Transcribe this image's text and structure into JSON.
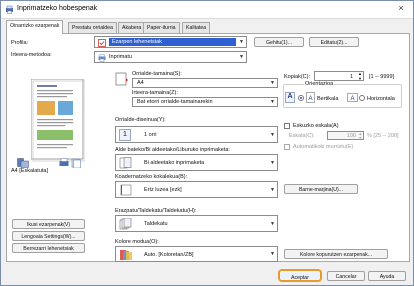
{
  "window": {
    "title": "Inprimatzeko hobespenak",
    "close": "×"
  },
  "tabs": [
    {
      "label": "Oinarrizko ezarpenak"
    },
    {
      "label": "Prestatu orrialdea"
    },
    {
      "label": "Akabera"
    },
    {
      "label": "Paper-iturria"
    },
    {
      "label": "Kalitatea"
    }
  ],
  "profile": {
    "label": "Profila:",
    "value": "Ezarpen lehenetsiak",
    "add_button": "Gehitu(1)...",
    "edit_button": "Editatu(2)..."
  },
  "output": {
    "label": "Irteera-metodoa:",
    "value": "Inprimatu"
  },
  "preview": {
    "paper_label": "A4 [Eskalatuta]"
  },
  "original_size": {
    "label": "Orrialde-tamaina(S):",
    "value": "A4"
  },
  "output_size": {
    "label": "Irteera-tamaina(Z):",
    "value": "Bat etorri orrialde-tamainarekin"
  },
  "copies": {
    "label": "Kopiak(C):",
    "value": "1",
    "range": "[1 -- 9999]"
  },
  "orientation": {
    "label": "Orientazioa",
    "vertical": "Bertikala",
    "horizontal": "Horizontala",
    "selected": "vertical"
  },
  "layout": {
    "label": "Orrialde-diseinua(Y):",
    "value": "1 orri"
  },
  "manual_scaling": {
    "label": "Eskuzko eskala(A)",
    "scale_label": "Eskala(C):",
    "scale_value": "100",
    "scale_range": "% [25 -- 200]"
  },
  "auto_reduce": {
    "label": "Automatikoki murriztu(E)"
  },
  "one_two_sided": {
    "label": "Alde bateko/Bi aldeetako/Liburuko inprimaketa:",
    "value": "Bi aldeetako inprimaketa"
  },
  "binding": {
    "label": "Koadernatzeko kokalekua(B):",
    "value": "Ertz luzea [ezk]",
    "margin_button": "Barne-marjina(U)..."
  },
  "finishing": {
    "label": "Erazpatu/Taldekatu/Taldekatu(H):",
    "value": "Taldekatu"
  },
  "color_mode": {
    "label": "Kolore modua(O):",
    "value": "Auto. [Koloretan/ZB]",
    "button": "Kolore kopurutzen ezarpenak..."
  },
  "side_buttons": {
    "profile_display": "Ikusi ezarpenak(V)",
    "language": "Lengoaia Settings(W)...",
    "restore": "Berrezarri lehenetsiak"
  },
  "footer": {
    "ok": "Aceptar",
    "cancel": "Cancelar",
    "help": "Ayuda"
  },
  "colors": {
    "accent": "#3a62c8",
    "focus": "#e89a2a"
  }
}
